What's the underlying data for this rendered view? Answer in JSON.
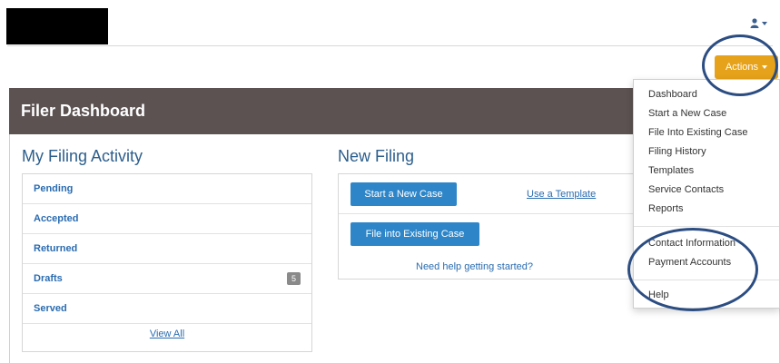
{
  "header": {
    "title": "Filer Dashboard",
    "actions_label": "Actions"
  },
  "activity": {
    "title": "My Filing Activity",
    "items": [
      {
        "label": "Pending",
        "count": ""
      },
      {
        "label": "Accepted",
        "count": ""
      },
      {
        "label": "Returned",
        "count": ""
      },
      {
        "label": "Drafts",
        "count": "5"
      },
      {
        "label": "Served",
        "count": ""
      }
    ],
    "view_all": "View All"
  },
  "new_filing": {
    "title": "New Filing",
    "start_new_case": "Start a New Case",
    "use_template": "Use a Template",
    "file_existing": "File into Existing Case",
    "help": "Need help getting started?"
  },
  "actions_menu": {
    "items": [
      "Dashboard",
      "Start a New Case",
      "File Into Existing Case",
      "Filing History",
      "Templates",
      "Service Contacts",
      "Reports",
      "Contact Information",
      "Payment Accounts",
      "Help"
    ]
  },
  "colors": {
    "accent": "#e6a21a",
    "header_bg": "#5c5252",
    "primary_button": "#2e86c8",
    "link": "#2a6cb0",
    "highlight_circle": "#2b4d82"
  }
}
